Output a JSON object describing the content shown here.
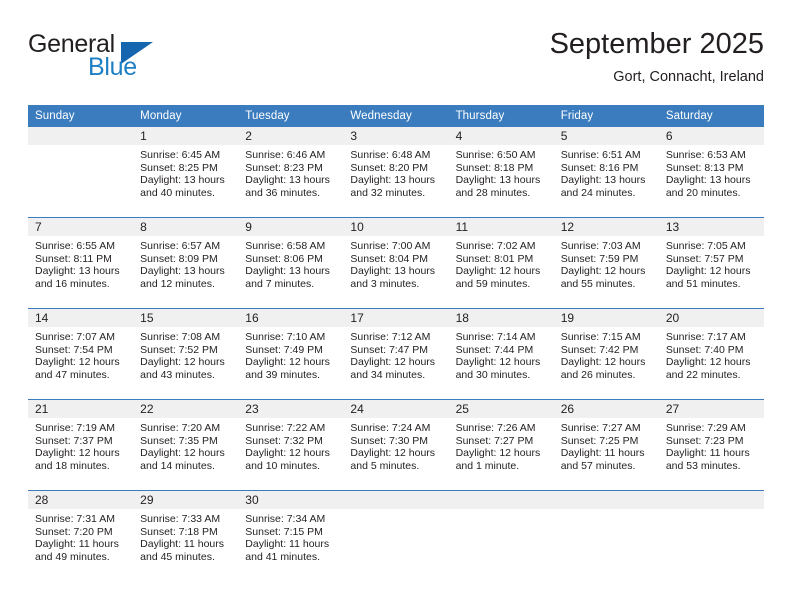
{
  "brand": {
    "word_one": "General",
    "word_two": "Blue",
    "logo_icon": "triangle-logo-icon"
  },
  "header": {
    "title": "September 2025",
    "subtitle": "Gort, Connacht, Ireland"
  },
  "calendar": {
    "weekday_headers": [
      "Sunday",
      "Monday",
      "Tuesday",
      "Wednesday",
      "Thursday",
      "Friday",
      "Saturday"
    ],
    "colors": {
      "header_blue": "#3b7cbf",
      "daynum_strip": "#f0f0f0",
      "brand_blue": "#1f7fc4",
      "text": "#231f20"
    },
    "weeks": [
      [
        {
          "day": "",
          "sunrise": "",
          "sunset": "",
          "daylight_line1": "",
          "daylight_line2": ""
        },
        {
          "day": "1",
          "sunrise": "Sunrise: 6:45 AM",
          "sunset": "Sunset: 8:25 PM",
          "daylight_line1": "Daylight: 13 hours",
          "daylight_line2": "and 40 minutes."
        },
        {
          "day": "2",
          "sunrise": "Sunrise: 6:46 AM",
          "sunset": "Sunset: 8:23 PM",
          "daylight_line1": "Daylight: 13 hours",
          "daylight_line2": "and 36 minutes."
        },
        {
          "day": "3",
          "sunrise": "Sunrise: 6:48 AM",
          "sunset": "Sunset: 8:20 PM",
          "daylight_line1": "Daylight: 13 hours",
          "daylight_line2": "and 32 minutes."
        },
        {
          "day": "4",
          "sunrise": "Sunrise: 6:50 AM",
          "sunset": "Sunset: 8:18 PM",
          "daylight_line1": "Daylight: 13 hours",
          "daylight_line2": "and 28 minutes."
        },
        {
          "day": "5",
          "sunrise": "Sunrise: 6:51 AM",
          "sunset": "Sunset: 8:16 PM",
          "daylight_line1": "Daylight: 13 hours",
          "daylight_line2": "and 24 minutes."
        },
        {
          "day": "6",
          "sunrise": "Sunrise: 6:53 AM",
          "sunset": "Sunset: 8:13 PM",
          "daylight_line1": "Daylight: 13 hours",
          "daylight_line2": "and 20 minutes."
        }
      ],
      [
        {
          "day": "7",
          "sunrise": "Sunrise: 6:55 AM",
          "sunset": "Sunset: 8:11 PM",
          "daylight_line1": "Daylight: 13 hours",
          "daylight_line2": "and 16 minutes."
        },
        {
          "day": "8",
          "sunrise": "Sunrise: 6:57 AM",
          "sunset": "Sunset: 8:09 PM",
          "daylight_line1": "Daylight: 13 hours",
          "daylight_line2": "and 12 minutes."
        },
        {
          "day": "9",
          "sunrise": "Sunrise: 6:58 AM",
          "sunset": "Sunset: 8:06 PM",
          "daylight_line1": "Daylight: 13 hours",
          "daylight_line2": "and 7 minutes."
        },
        {
          "day": "10",
          "sunrise": "Sunrise: 7:00 AM",
          "sunset": "Sunset: 8:04 PM",
          "daylight_line1": "Daylight: 13 hours",
          "daylight_line2": "and 3 minutes."
        },
        {
          "day": "11",
          "sunrise": "Sunrise: 7:02 AM",
          "sunset": "Sunset: 8:01 PM",
          "daylight_line1": "Daylight: 12 hours",
          "daylight_line2": "and 59 minutes."
        },
        {
          "day": "12",
          "sunrise": "Sunrise: 7:03 AM",
          "sunset": "Sunset: 7:59 PM",
          "daylight_line1": "Daylight: 12 hours",
          "daylight_line2": "and 55 minutes."
        },
        {
          "day": "13",
          "sunrise": "Sunrise: 7:05 AM",
          "sunset": "Sunset: 7:57 PM",
          "daylight_line1": "Daylight: 12 hours",
          "daylight_line2": "and 51 minutes."
        }
      ],
      [
        {
          "day": "14",
          "sunrise": "Sunrise: 7:07 AM",
          "sunset": "Sunset: 7:54 PM",
          "daylight_line1": "Daylight: 12 hours",
          "daylight_line2": "and 47 minutes."
        },
        {
          "day": "15",
          "sunrise": "Sunrise: 7:08 AM",
          "sunset": "Sunset: 7:52 PM",
          "daylight_line1": "Daylight: 12 hours",
          "daylight_line2": "and 43 minutes."
        },
        {
          "day": "16",
          "sunrise": "Sunrise: 7:10 AM",
          "sunset": "Sunset: 7:49 PM",
          "daylight_line1": "Daylight: 12 hours",
          "daylight_line2": "and 39 minutes."
        },
        {
          "day": "17",
          "sunrise": "Sunrise: 7:12 AM",
          "sunset": "Sunset: 7:47 PM",
          "daylight_line1": "Daylight: 12 hours",
          "daylight_line2": "and 34 minutes."
        },
        {
          "day": "18",
          "sunrise": "Sunrise: 7:14 AM",
          "sunset": "Sunset: 7:44 PM",
          "daylight_line1": "Daylight: 12 hours",
          "daylight_line2": "and 30 minutes."
        },
        {
          "day": "19",
          "sunrise": "Sunrise: 7:15 AM",
          "sunset": "Sunset: 7:42 PM",
          "daylight_line1": "Daylight: 12 hours",
          "daylight_line2": "and 26 minutes."
        },
        {
          "day": "20",
          "sunrise": "Sunrise: 7:17 AM",
          "sunset": "Sunset: 7:40 PM",
          "daylight_line1": "Daylight: 12 hours",
          "daylight_line2": "and 22 minutes."
        }
      ],
      [
        {
          "day": "21",
          "sunrise": "Sunrise: 7:19 AM",
          "sunset": "Sunset: 7:37 PM",
          "daylight_line1": "Daylight: 12 hours",
          "daylight_line2": "and 18 minutes."
        },
        {
          "day": "22",
          "sunrise": "Sunrise: 7:20 AM",
          "sunset": "Sunset: 7:35 PM",
          "daylight_line1": "Daylight: 12 hours",
          "daylight_line2": "and 14 minutes."
        },
        {
          "day": "23",
          "sunrise": "Sunrise: 7:22 AM",
          "sunset": "Sunset: 7:32 PM",
          "daylight_line1": "Daylight: 12 hours",
          "daylight_line2": "and 10 minutes."
        },
        {
          "day": "24",
          "sunrise": "Sunrise: 7:24 AM",
          "sunset": "Sunset: 7:30 PM",
          "daylight_line1": "Daylight: 12 hours",
          "daylight_line2": "and 5 minutes."
        },
        {
          "day": "25",
          "sunrise": "Sunrise: 7:26 AM",
          "sunset": "Sunset: 7:27 PM",
          "daylight_line1": "Daylight: 12 hours",
          "daylight_line2": "and 1 minute."
        },
        {
          "day": "26",
          "sunrise": "Sunrise: 7:27 AM",
          "sunset": "Sunset: 7:25 PM",
          "daylight_line1": "Daylight: 11 hours",
          "daylight_line2": "and 57 minutes."
        },
        {
          "day": "27",
          "sunrise": "Sunrise: 7:29 AM",
          "sunset": "Sunset: 7:23 PM",
          "daylight_line1": "Daylight: 11 hours",
          "daylight_line2": "and 53 minutes."
        }
      ],
      [
        {
          "day": "28",
          "sunrise": "Sunrise: 7:31 AM",
          "sunset": "Sunset: 7:20 PM",
          "daylight_line1": "Daylight: 11 hours",
          "daylight_line2": "and 49 minutes."
        },
        {
          "day": "29",
          "sunrise": "Sunrise: 7:33 AM",
          "sunset": "Sunset: 7:18 PM",
          "daylight_line1": "Daylight: 11 hours",
          "daylight_line2": "and 45 minutes."
        },
        {
          "day": "30",
          "sunrise": "Sunrise: 7:34 AM",
          "sunset": "Sunset: 7:15 PM",
          "daylight_line1": "Daylight: 11 hours",
          "daylight_line2": "and 41 minutes."
        },
        {
          "day": "",
          "sunrise": "",
          "sunset": "",
          "daylight_line1": "",
          "daylight_line2": ""
        },
        {
          "day": "",
          "sunrise": "",
          "sunset": "",
          "daylight_line1": "",
          "daylight_line2": ""
        },
        {
          "day": "",
          "sunrise": "",
          "sunset": "",
          "daylight_line1": "",
          "daylight_line2": ""
        },
        {
          "day": "",
          "sunrise": "",
          "sunset": "",
          "daylight_line1": "",
          "daylight_line2": ""
        }
      ]
    ]
  }
}
